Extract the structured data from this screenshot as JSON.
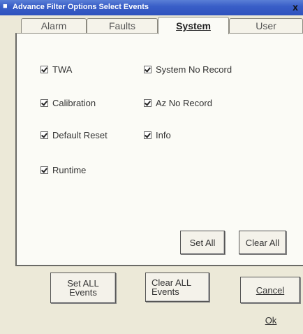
{
  "window": {
    "title": "Advance Filter Options   Select Events",
    "close_label": "x"
  },
  "tabs": [
    {
      "label": "Alarm",
      "active": false
    },
    {
      "label": "Faults",
      "active": false
    },
    {
      "label": "System",
      "active": true
    },
    {
      "label": "User",
      "active": false
    }
  ],
  "checkboxes": [
    {
      "label": "TWA",
      "checked": true
    },
    {
      "label": "Calibration",
      "checked": true
    },
    {
      "label": "Default Reset",
      "checked": true
    },
    {
      "label": "Runtime",
      "checked": true
    },
    {
      "label": "System No Record",
      "checked": true
    },
    {
      "label": "Az No Record",
      "checked": true
    },
    {
      "label": "Info",
      "checked": true
    }
  ],
  "panel_buttons": {
    "set_all": "Set All",
    "clear_all": "Clear All"
  },
  "footer_buttons": {
    "set_all_events_1": "Set ALL",
    "set_all_events_2": "Events",
    "clear_all_events_1": "Clear ALL",
    "clear_all_events_2": "Events",
    "cancel": "Cancel",
    "ok": "Ok"
  },
  "colors": {
    "titlebar": "#2e52bd",
    "window_bg": "#ece9d8",
    "panel_bg": "#fbfbf6"
  }
}
